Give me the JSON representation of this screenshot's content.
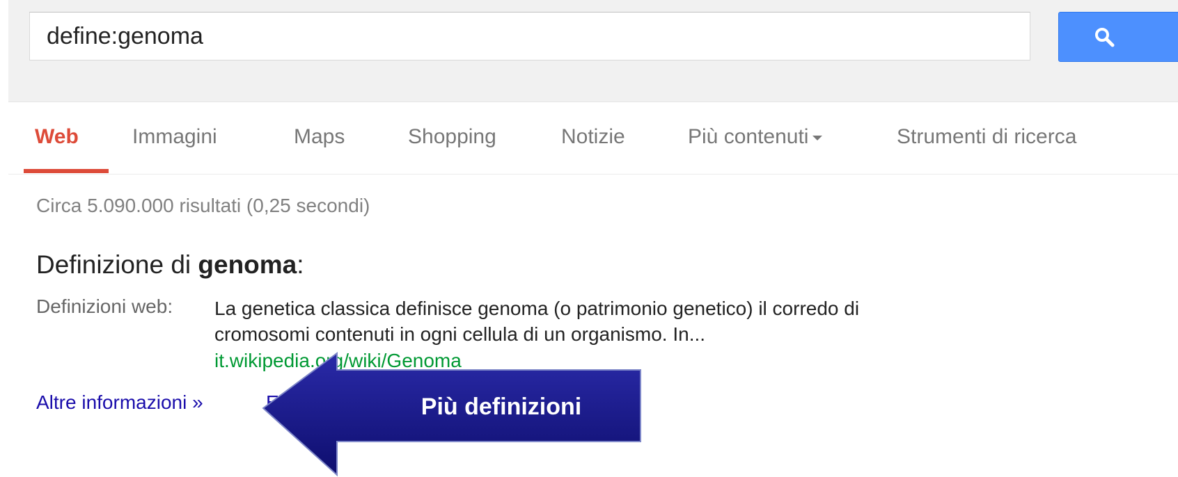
{
  "search": {
    "query": "define:genoma"
  },
  "nav": {
    "tabs": [
      {
        "label": "Web",
        "active": true
      },
      {
        "label": "Immagini",
        "active": false
      },
      {
        "label": "Maps",
        "active": false
      },
      {
        "label": "Shopping",
        "active": false
      },
      {
        "label": "Notizie",
        "active": false
      },
      {
        "label": "Più contenuti",
        "active": false
      },
      {
        "label": "Strumenti di ricerca",
        "active": false
      }
    ]
  },
  "results": {
    "stats": "Circa 5.090.000 risultati (0,25 secondi)",
    "definition": {
      "title_prefix": "Definizione di ",
      "title_term": "genoma",
      "title_suffix": ":",
      "label": "Definizioni web:",
      "text": "La genetica classica definisce genoma (o patrimonio genetico) il corredo di cromosomi contenuti in ogni cellula di un organismo. In...",
      "url": "it.wikipedia.org/wiki/Genoma"
    },
    "more_info_link": "Altre informazioni »",
    "second_link_partial": "E"
  },
  "annotation": {
    "arrow_text": "Più definizioni"
  },
  "colors": {
    "active_tab": "#dd4b39",
    "search_button": "#4d90fe",
    "link": "#1a0dab",
    "url": "#009933",
    "arrow_fill": "#1a1a8c"
  },
  "icons": {
    "search_button_icon": "search-icon",
    "tab_dropdown_icon": "caret-down-icon"
  }
}
